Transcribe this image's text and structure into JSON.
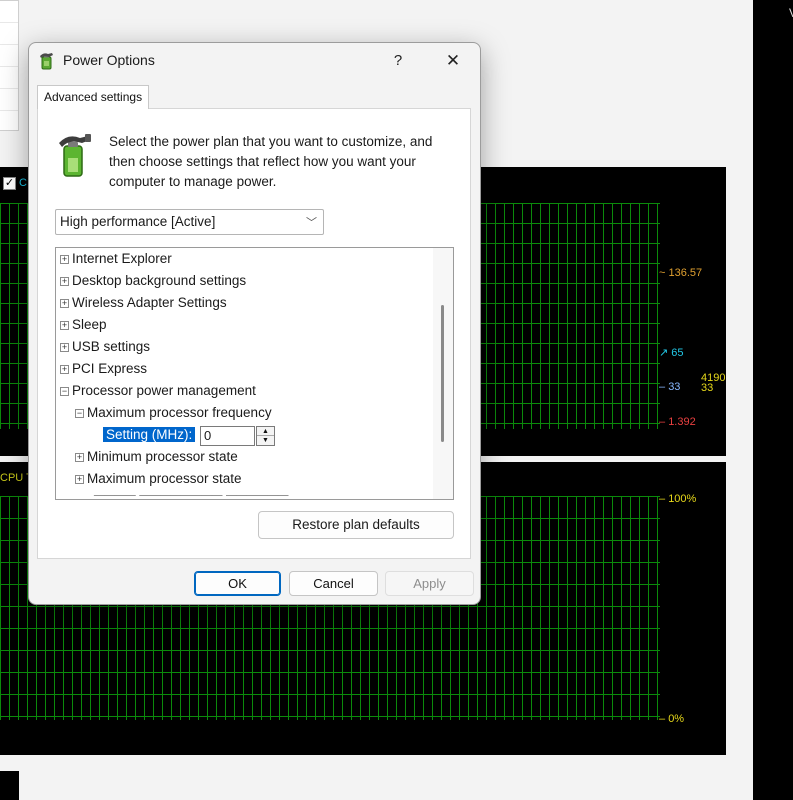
{
  "background": {
    "right_panel_text": "V",
    "graph1": {
      "checkbox_label": "C",
      "labels": {
        "top": "136.57",
        "middle": "65",
        "lower_left": "33",
        "lower_right_top": "4190",
        "lower_right_bottom": "33",
        "bottom": "1.392"
      }
    },
    "graph2": {
      "title": "CPU T",
      "labels": {
        "top": "100%",
        "bottom": "0%"
      }
    }
  },
  "dialog": {
    "title": "Power Options",
    "help_label": "?",
    "close_label": "✕",
    "tab_label": "Advanced settings",
    "intro_text": "Select the power plan that you want to customize, and then choose settings that reflect how you want your computer to manage power.",
    "plan_select": {
      "value": "High performance [Active]"
    },
    "tree": {
      "items": [
        {
          "label": "Internet Explorer",
          "state": "collapsed",
          "level": 0
        },
        {
          "label": "Desktop background settings",
          "state": "collapsed",
          "level": 0
        },
        {
          "label": "Wireless Adapter Settings",
          "state": "collapsed",
          "level": 0
        },
        {
          "label": "Sleep",
          "state": "collapsed",
          "level": 0
        },
        {
          "label": "USB settings",
          "state": "collapsed",
          "level": 0
        },
        {
          "label": "PCI Express",
          "state": "collapsed",
          "level": 0
        },
        {
          "label": "Processor power management",
          "state": "expanded",
          "level": 0
        },
        {
          "label": "Maximum processor frequency",
          "state": "expanded",
          "level": 1
        },
        {
          "label": "Minimum processor state",
          "state": "collapsed",
          "level": 1
        },
        {
          "label": "Maximum processor state",
          "state": "collapsed",
          "level": 1
        }
      ],
      "setting": {
        "label": "Setting (MHz):",
        "value": "0"
      }
    },
    "restore_button": "Restore plan defaults",
    "buttons": {
      "ok": "OK",
      "cancel": "Cancel",
      "apply": "Apply"
    }
  },
  "colors": {
    "graph_grid": "#0b8a0b",
    "selection_blue": "#0066cc",
    "ok_border": "#0067c0"
  }
}
